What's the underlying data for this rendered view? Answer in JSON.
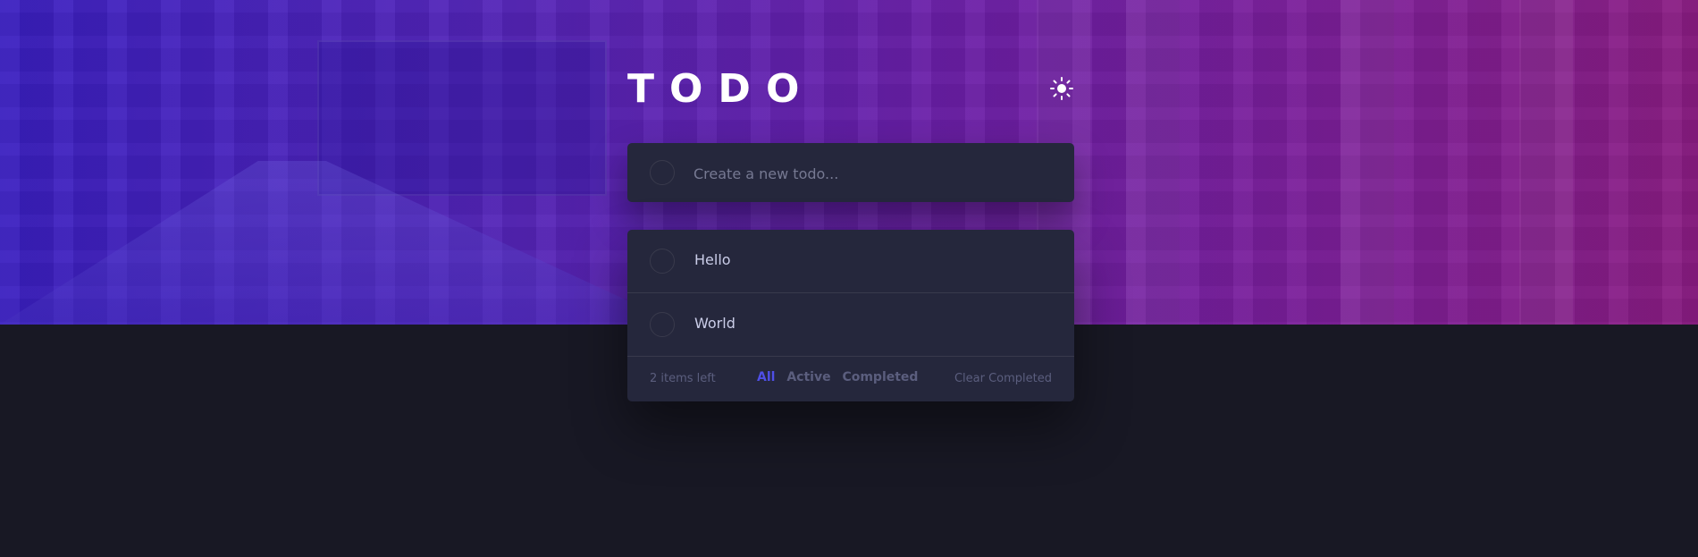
{
  "app": {
    "title": "TODO"
  },
  "theme_toggle": {
    "icon": "sun-icon"
  },
  "new_todo": {
    "placeholder": "Create a new todo..."
  },
  "todos": [
    {
      "text": "Hello",
      "completed": false
    },
    {
      "text": "World",
      "completed": false
    }
  ],
  "footer": {
    "items_left": "2 items left",
    "filters": [
      "All",
      "Active",
      "Completed"
    ],
    "active_filter": "All",
    "clear_label": "Clear Completed"
  },
  "colors": {
    "accent": "#4f4fe6",
    "card_bg": "#25273c",
    "page_bg": "#181824"
  }
}
